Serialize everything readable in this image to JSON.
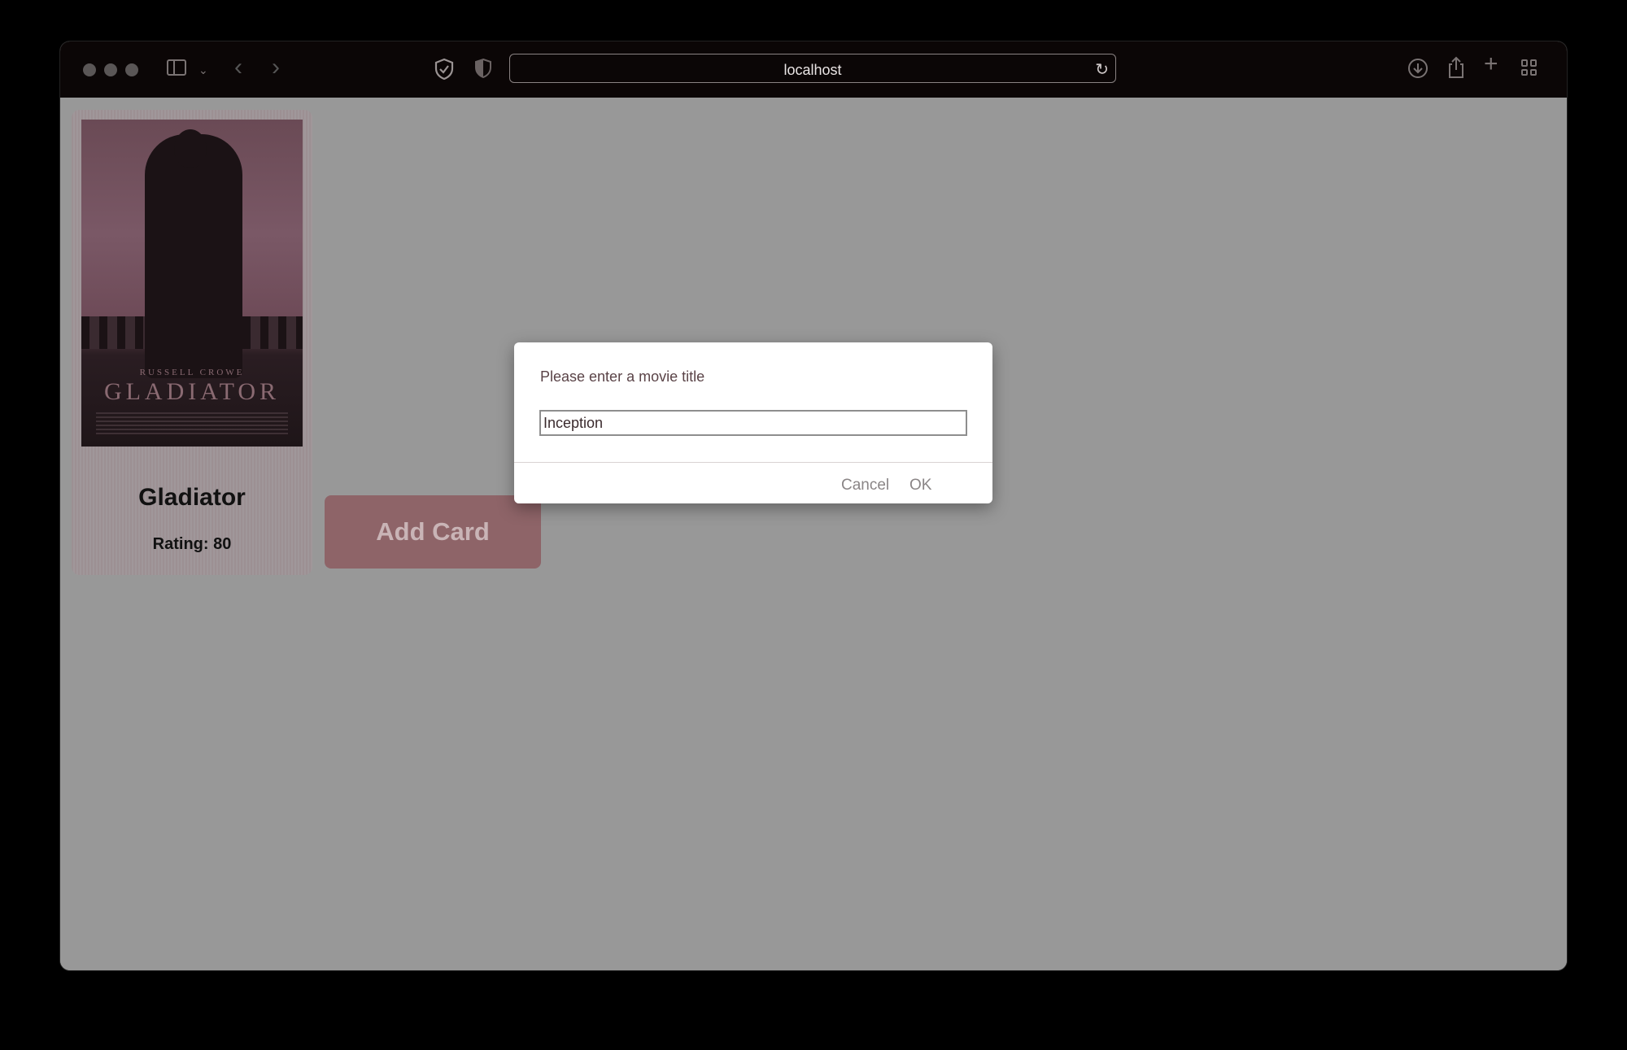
{
  "browser": {
    "url": "localhost",
    "icons": {
      "sidebar": "sidebar-icon",
      "back": "chevron-left-icon",
      "forward": "chevron-right-icon",
      "privacy": "shield-icon",
      "reload": "reload-icon",
      "download": "download-icon",
      "share": "share-icon",
      "new_tab": "plus-icon",
      "tab_overview": "grid-icon"
    }
  },
  "card": {
    "title": "Gladiator",
    "rating": "Rating: 80",
    "poster": {
      "actor": "RUSSELL CROWE",
      "title": "GLADIATOR"
    }
  },
  "add_button": {
    "label": "Add Card"
  },
  "dialog": {
    "message": "Please enter a movie title",
    "input_value": "Inception",
    "cancel_label": "Cancel",
    "ok_label": "OK"
  },
  "colors": {
    "overlay": "#989898",
    "button": "#8e6468",
    "toolbar": "#0b0606"
  }
}
